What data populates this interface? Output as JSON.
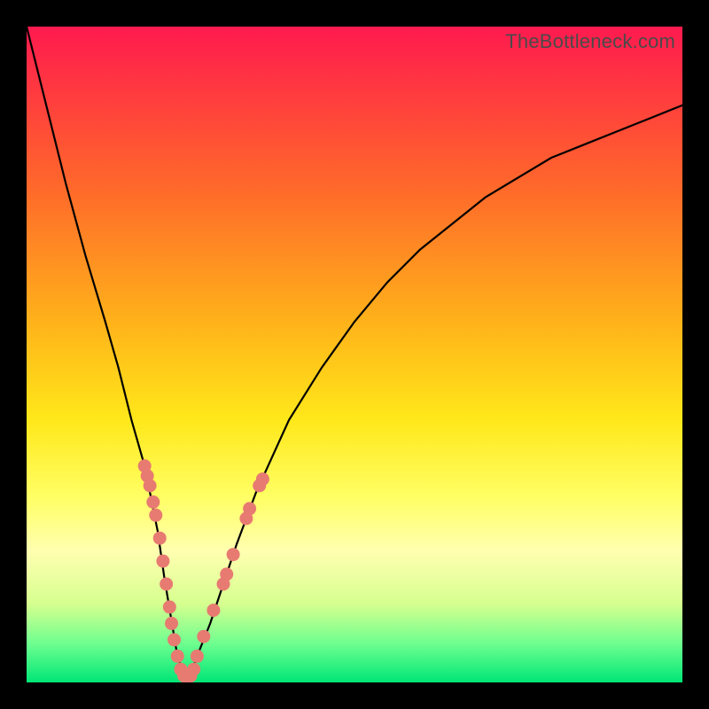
{
  "watermark": "TheBottleneck.com",
  "chart_data": {
    "type": "line",
    "title": "",
    "xlabel": "",
    "ylabel": "",
    "xlim": [
      0,
      100
    ],
    "ylim": [
      0,
      100
    ],
    "series": [
      {
        "name": "bottleneck-curve",
        "x": [
          0,
          3,
          6,
          9,
          12,
          14,
          16,
          18,
          20,
          21,
          22,
          23,
          24,
          25,
          26,
          28,
          30,
          32,
          35,
          40,
          45,
          50,
          55,
          60,
          65,
          70,
          75,
          80,
          85,
          90,
          95,
          100
        ],
        "y": [
          100,
          88,
          76,
          65,
          55,
          48,
          40,
          33,
          23,
          16,
          10,
          4,
          1,
          1,
          4,
          9,
          15,
          21,
          29,
          40,
          48,
          55,
          61,
          66,
          70,
          74,
          77,
          80,
          82,
          84,
          86,
          88
        ]
      }
    ],
    "highlight_points": {
      "name": "dotted-segments",
      "points": [
        {
          "x": 18.0,
          "y": 33.0
        },
        {
          "x": 18.4,
          "y": 31.5
        },
        {
          "x": 18.8,
          "y": 30.0
        },
        {
          "x": 19.3,
          "y": 27.5
        },
        {
          "x": 19.7,
          "y": 25.5
        },
        {
          "x": 20.3,
          "y": 22.0
        },
        {
          "x": 20.8,
          "y": 18.5
        },
        {
          "x": 21.3,
          "y": 15.0
        },
        {
          "x": 21.8,
          "y": 11.5
        },
        {
          "x": 22.1,
          "y": 9.0
        },
        {
          "x": 22.5,
          "y": 6.5
        },
        {
          "x": 23.0,
          "y": 4.0
        },
        {
          "x": 23.5,
          "y": 2.0
        },
        {
          "x": 24.0,
          "y": 1.0
        },
        {
          "x": 24.5,
          "y": 1.0
        },
        {
          "x": 25.0,
          "y": 1.0
        },
        {
          "x": 25.5,
          "y": 2.0
        },
        {
          "x": 26.0,
          "y": 4.0
        },
        {
          "x": 27.0,
          "y": 7.0
        },
        {
          "x": 28.5,
          "y": 11.0
        },
        {
          "x": 30.0,
          "y": 15.0
        },
        {
          "x": 30.5,
          "y": 16.5
        },
        {
          "x": 31.5,
          "y": 19.5
        },
        {
          "x": 33.5,
          "y": 25.0
        },
        {
          "x": 34.0,
          "y": 26.5
        },
        {
          "x": 35.5,
          "y": 30.0
        },
        {
          "x": 36.0,
          "y": 31.0
        }
      ]
    },
    "background_gradient": {
      "top_color": "#ff1a4f",
      "bottom_color": "#00e676",
      "stops": [
        "red",
        "orange",
        "yellow",
        "green"
      ]
    }
  }
}
